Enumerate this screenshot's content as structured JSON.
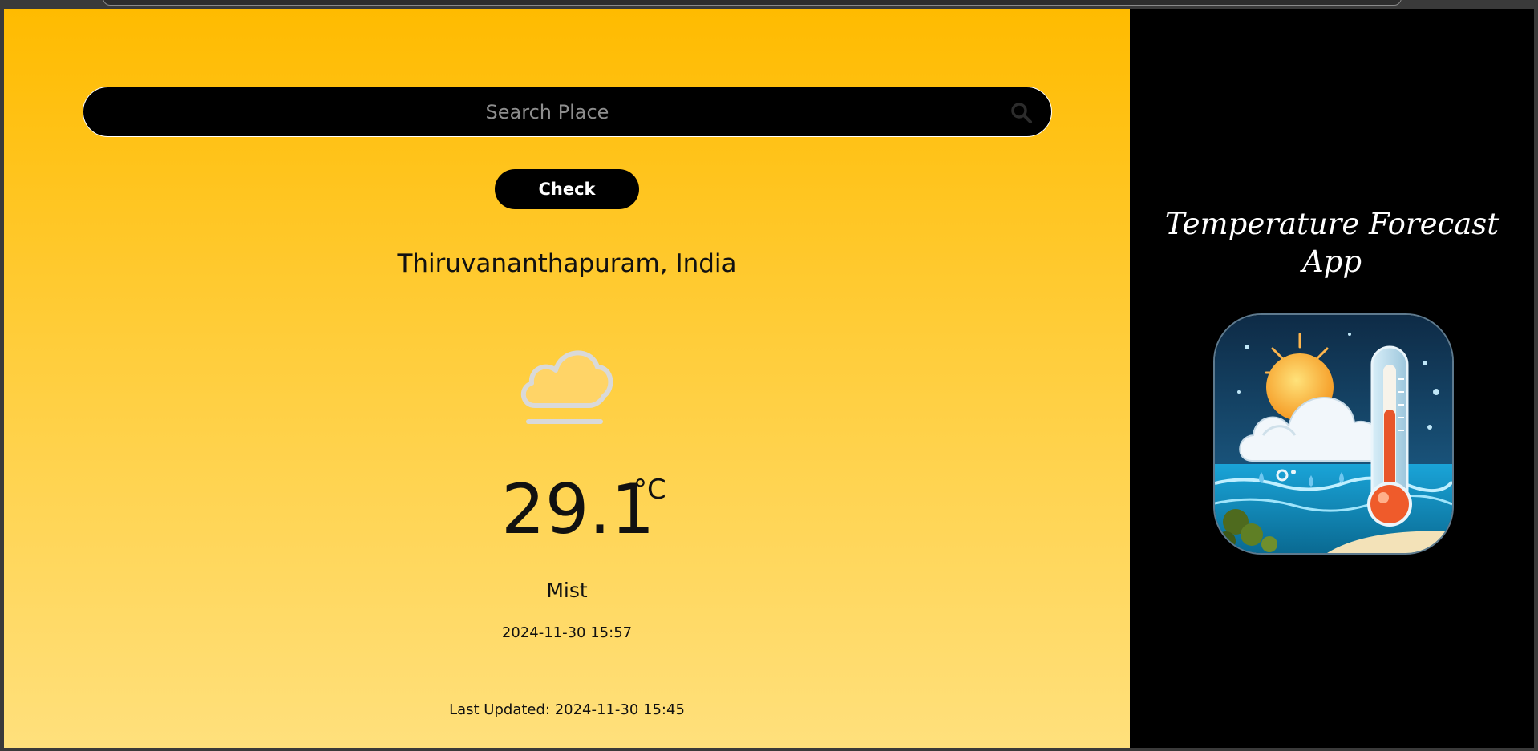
{
  "search": {
    "placeholder": "Search Place",
    "value": ""
  },
  "check_button": {
    "label": "Check"
  },
  "location": {
    "text": "Thiruvananthapuram, India"
  },
  "weather": {
    "icon": "mist-cloud-icon",
    "temperature": "29.1",
    "unit": "°C",
    "description": "Mist",
    "local_time": "2024-11-30 15:57",
    "last_updated": "Last Updated: 2024-11-30 15:45"
  },
  "app": {
    "title_line1": "Temperature Forecast",
    "title_line2": "App",
    "logo_icon": "weather-thermometer-logo"
  },
  "colors": {
    "gradient_top": "#ffbb00",
    "gradient_bottom": "#ffe07c",
    "panel_bg": "#000000",
    "text": "#111111"
  }
}
